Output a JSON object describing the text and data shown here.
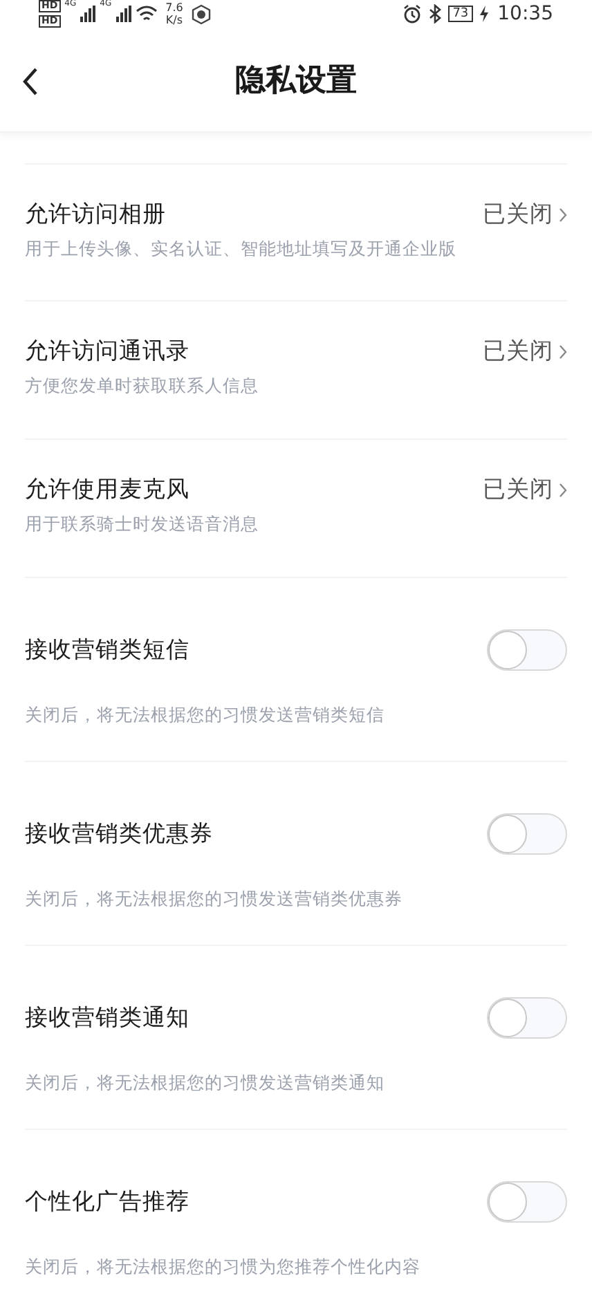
{
  "status_bar": {
    "sim_labels": [
      "HD",
      "HD"
    ],
    "network_labels": [
      "4G",
      "4G"
    ],
    "speed": "7.6",
    "speed_unit": "K/s",
    "battery": "73",
    "time": "10:35"
  },
  "header": {
    "title": "隐私设置"
  },
  "items": [
    {
      "kind": "link",
      "title": "允许访问相册",
      "subtitle": "用于上传头像、实名认证、智能地址填写及开通企业版",
      "value": "已关闭"
    },
    {
      "kind": "link",
      "title": "允许访问通讯录",
      "subtitle": "方便您发单时获取联系人信息",
      "value": "已关闭"
    },
    {
      "kind": "link",
      "title": "允许使用麦克风",
      "subtitle": "用于联系骑士时发送语音消息",
      "value": "已关闭"
    },
    {
      "kind": "toggle",
      "title": "接收营销类短信",
      "subtitle": "关闭后，将无法根据您的习惯发送营销类短信",
      "on": false
    },
    {
      "kind": "toggle",
      "title": "接收营销类优惠券",
      "subtitle": "关闭后，将无法根据您的习惯发送营销类优惠券",
      "on": false
    },
    {
      "kind": "toggle",
      "title": "接收营销类通知",
      "subtitle": "关闭后，将无法根据您的习惯发送营销类通知",
      "on": false
    },
    {
      "kind": "toggle",
      "title": "个性化广告推荐",
      "subtitle": "关闭后，将无法根据您的习惯为您推荐个性化内容",
      "on": false
    }
  ]
}
